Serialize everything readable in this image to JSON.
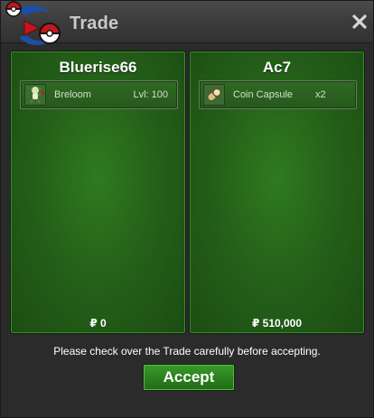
{
  "window": {
    "title": "Trade"
  },
  "left_panel": {
    "player_name": "Bluerise66",
    "item": {
      "icon": "breloom-sprite-icon",
      "name": "Breloom",
      "meta": "Lvl: 100"
    },
    "money": "₽ 0"
  },
  "right_panel": {
    "player_name": "Ac7",
    "item": {
      "icon": "coin-capsule-icon",
      "name": "Coin Capsule",
      "meta": "x2"
    },
    "money": "₽ 510,000"
  },
  "footer": {
    "notice": "Please check over the Trade carefully before accepting.",
    "accept_label": "Accept"
  },
  "colors": {
    "panel_green": "#235d18",
    "accent_red": "#c4161c",
    "accent_blue": "#1c4fa8"
  }
}
